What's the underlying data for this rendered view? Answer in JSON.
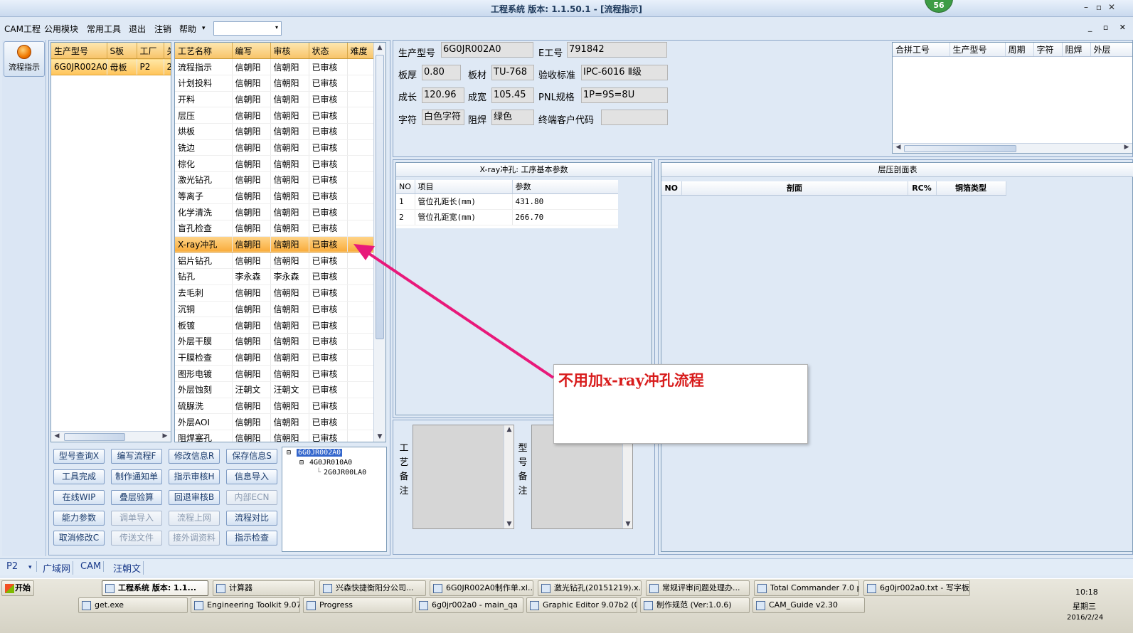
{
  "window": {
    "title": "工程系统  版本: 1.1.50.1 - [流程指示]",
    "badge": "56",
    "controls": [
      "–",
      "▫",
      "✕"
    ]
  },
  "menu": {
    "items": [
      "CAM工程",
      "公用模块",
      "常用工具",
      "退出",
      "注销",
      "帮助"
    ],
    "dropdown_arrow": "▾",
    "mdi_controls": "_ ▫ ✕"
  },
  "leftbar": {
    "button_label": "流程指示"
  },
  "orders": {
    "columns": [
      "生产型号",
      "S板",
      "工厂",
      "关"
    ],
    "rows": [
      [
        "6G0JR002A0",
        "母板",
        "P2",
        "2"
      ]
    ]
  },
  "process": {
    "columns": [
      "工艺名称",
      "编写",
      "审核",
      "状态",
      "难度"
    ],
    "rows": [
      [
        "流程指示",
        "信朝阳",
        "信朝阳",
        "已审核",
        ""
      ],
      [
        "计划投料",
        "信朝阳",
        "信朝阳",
        "已审核",
        ""
      ],
      [
        "开料",
        "信朝阳",
        "信朝阳",
        "已审核",
        ""
      ],
      [
        "层压",
        "信朝阳",
        "信朝阳",
        "已审核",
        ""
      ],
      [
        "烘板",
        "信朝阳",
        "信朝阳",
        "已审核",
        ""
      ],
      [
        "铣边",
        "信朝阳",
        "信朝阳",
        "已审核",
        ""
      ],
      [
        "棕化",
        "信朝阳",
        "信朝阳",
        "已审核",
        ""
      ],
      [
        "激光钻孔",
        "信朝阳",
        "信朝阳",
        "已审核",
        ""
      ],
      [
        "等离子",
        "信朝阳",
        "信朝阳",
        "已审核",
        ""
      ],
      [
        "化学清洗",
        "信朝阳",
        "信朝阳",
        "已审核",
        ""
      ],
      [
        "盲孔检查",
        "信朝阳",
        "信朝阳",
        "已审核",
        ""
      ],
      [
        "X-ray冲孔",
        "信朝阳",
        "信朝阳",
        "已审核",
        ""
      ],
      [
        "铝片钻孔",
        "信朝阳",
        "信朝阳",
        "已审核",
        ""
      ],
      [
        "钻孔",
        "李永森",
        "李永森",
        "已审核",
        ""
      ],
      [
        "去毛刺",
        "信朝阳",
        "信朝阳",
        "已审核",
        ""
      ],
      [
        "沉铜",
        "信朝阳",
        "信朝阳",
        "已审核",
        ""
      ],
      [
        "板镀",
        "信朝阳",
        "信朝阳",
        "已审核",
        ""
      ],
      [
        "外层干膜",
        "信朝阳",
        "信朝阳",
        "已审核",
        ""
      ],
      [
        "干膜检查",
        "信朝阳",
        "信朝阳",
        "已审核",
        ""
      ],
      [
        "图形电镀",
        "信朝阳",
        "信朝阳",
        "已审核",
        ""
      ],
      [
        "外层蚀刻",
        "汪朝文",
        "汪朝文",
        "已审核",
        ""
      ],
      [
        "硫脲洗",
        "信朝阳",
        "信朝阳",
        "已审核",
        ""
      ],
      [
        "外层AOI",
        "信朝阳",
        "信朝阳",
        "已审核",
        ""
      ],
      [
        "阻焊塞孔",
        "信朝阳",
        "信朝阳",
        "已审核",
        ""
      ]
    ],
    "selected_index": 11
  },
  "buttons": [
    {
      "label": "型号查询X",
      "enabled": true
    },
    {
      "label": "编写流程F",
      "enabled": true
    },
    {
      "label": "修改信息R",
      "enabled": true
    },
    {
      "label": "保存信息S",
      "enabled": true
    },
    {
      "label": "工具完成",
      "enabled": true
    },
    {
      "label": "制作通知单",
      "enabled": true
    },
    {
      "label": "指示审核H",
      "enabled": true
    },
    {
      "label": "信息导入",
      "enabled": true
    },
    {
      "label": "在线WIP",
      "enabled": true
    },
    {
      "label": "叠层验算",
      "enabled": true
    },
    {
      "label": "回退审核B",
      "enabled": true
    },
    {
      "label": "内部ECN",
      "enabled": false
    },
    {
      "label": "能力参数",
      "enabled": true
    },
    {
      "label": "调单导入",
      "enabled": false
    },
    {
      "label": "流程上网",
      "enabled": false
    },
    {
      "label": "流程对比",
      "enabled": true
    },
    {
      "label": "取消修改C",
      "enabled": true
    },
    {
      "label": "传送文件",
      "enabled": false
    },
    {
      "label": "接外调资料",
      "enabled": false
    },
    {
      "label": "指示检查",
      "enabled": true
    }
  ],
  "tree": {
    "root": "6G0JR002A0",
    "child": "4G0JR010A0",
    "grandchild": "2G0JR00LA0",
    "expander": "⊟"
  },
  "info": {
    "fields": [
      {
        "label": "生产型号",
        "value": "6G0JR002A0"
      },
      {
        "label": "E工号",
        "value": "791842"
      },
      {
        "label": "板厚",
        "value": "0.80"
      },
      {
        "label": "板材",
        "value": "TU-768"
      },
      {
        "label": "验收标准",
        "value": "IPC-6016 Ⅱ级"
      },
      {
        "label": "成长",
        "value": "120.96"
      },
      {
        "label": "成宽",
        "value": "105.45"
      },
      {
        "label": "PNL规格",
        "value": "1P=9S=8U"
      },
      {
        "label": "字符",
        "value": "白色字符"
      },
      {
        "label": "阻焊",
        "value": "绿色"
      },
      {
        "label": "终端客户代码",
        "value": ""
      }
    ]
  },
  "merge_grid": {
    "columns": [
      "合拼工号",
      "生产型号",
      "周期",
      "字符",
      "阻焊",
      "外层"
    ]
  },
  "xray_params": {
    "title": "X-ray冲孔: 工序基本参数",
    "columns": [
      "NO",
      "项目",
      "参数"
    ],
    "rows": [
      [
        "1",
        "管位孔距长(mm)",
        "431.80"
      ],
      [
        "2",
        "管位孔距宽(mm)",
        "266.70"
      ]
    ]
  },
  "stack": {
    "title": "层压剖面表",
    "columns": [
      "NO",
      "剖面",
      "RC%",
      "铜箔类型"
    ]
  },
  "remarks": {
    "process_label": "工艺备注",
    "model_label": "型号备注"
  },
  "callout": {
    "text": "不用加x-ray冲孔流程",
    "color": "#d81c1c",
    "arrow_color": "#e8197a"
  },
  "status": {
    "items": [
      "P2",
      "▾",
      "广域网",
      "CAM",
      "汪朝文"
    ]
  },
  "taskbar": {
    "start": "开始",
    "row1": [
      "工程系统  版本: 1.1...",
      "计算器",
      "兴森快捷衡阳分公司...",
      "6G0JR002A0制作单.xl...",
      "激光钻孔(20151219).x...",
      "常规评审问题处理办...",
      "Total Commander 7.0 p...",
      "6g0jr002a0.txt - 写字板"
    ],
    "row2": [
      "get.exe",
      "Engineering Toolkit 9.07...",
      "Progress",
      "6g0jr002a0 - main_qa",
      "Graphic Editor 9.07b2 (0...",
      "制作规范 (Ver:1.0.6)",
      "CAM_Guide v2.30"
    ],
    "clock": "10:18",
    "weekday": "星期三",
    "date": "2016/2/24"
  }
}
